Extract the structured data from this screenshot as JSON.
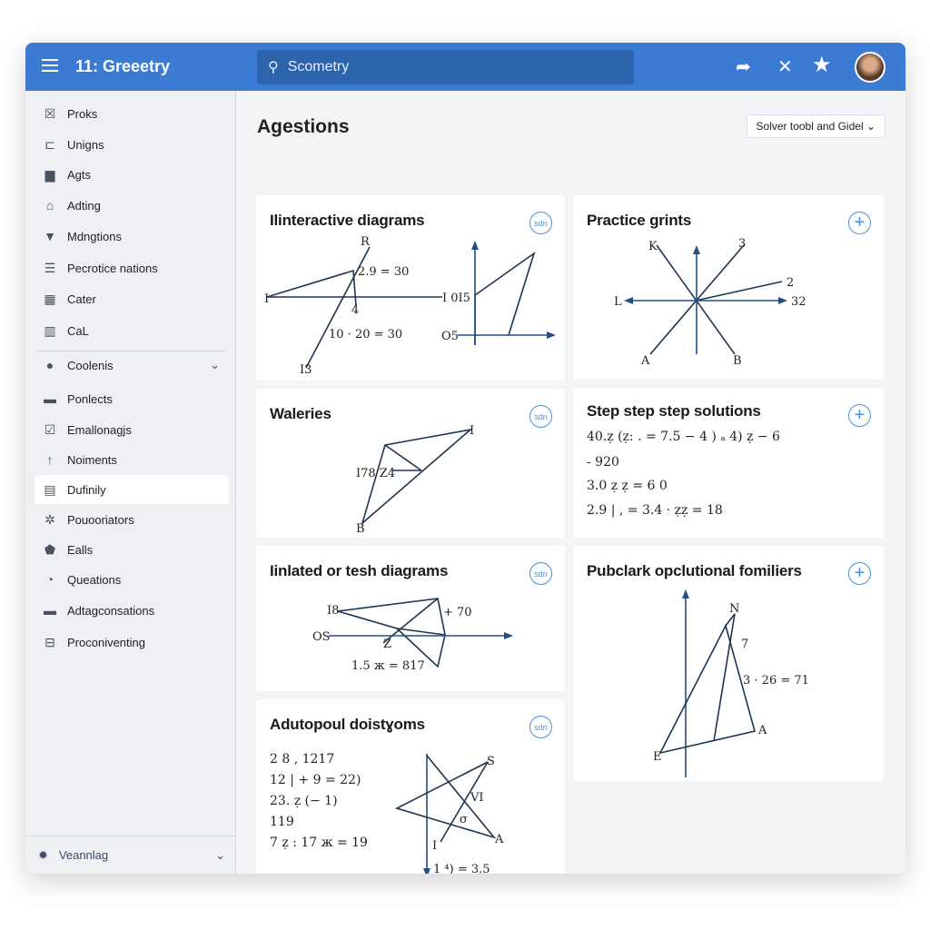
{
  "header": {
    "title": "11: Greeetry",
    "search_value": "Scometry",
    "icons": [
      "share-icon",
      "tools-icon",
      "star-icon"
    ]
  },
  "sidebar": {
    "items": [
      {
        "label": "Proks",
        "icon": "☒"
      },
      {
        "label": "Unigns",
        "icon": "⊏"
      },
      {
        "label": "Agts",
        "icon": "▆"
      },
      {
        "label": "Adting",
        "icon": "⌂"
      },
      {
        "label": "Mdngtions",
        "icon": "▼"
      },
      {
        "label": "Pecrotice nations",
        "icon": "☰"
      },
      {
        "label": "Cater",
        "icon": "▦"
      },
      {
        "label": "CaL",
        "icon": "▥"
      },
      {
        "label": "Coolenis",
        "icon": "●"
      },
      {
        "label": "Ponlects",
        "icon": "▬"
      },
      {
        "label": "Emallonagjs",
        "icon": "☑"
      },
      {
        "label": "Noiments",
        "icon": "↑"
      },
      {
        "label": "Dufinily",
        "icon": "▤"
      },
      {
        "label": "Pouooriators",
        "icon": "✲"
      },
      {
        "label": "Ealls",
        "icon": "⬟"
      },
      {
        "label": "Queations",
        "icon": "◔"
      },
      {
        "label": "Adtagconsations",
        "icon": "▬"
      },
      {
        "label": "Proconiventing",
        "icon": "⊟"
      }
    ],
    "active": "Dufinily",
    "footer": "Veannlag"
  },
  "main": {
    "title": "Agestions",
    "dropdown": "Solver toobl and Gidel",
    "cards": [
      {
        "title": "Ilinteractive diagrams",
        "button": "sdn",
        "labels": [
          "R",
          "2.9 = 30",
          "I",
          "4",
          "10 · 20 = 30",
          "I3",
          "I 0I5",
          "O5"
        ]
      },
      {
        "title": "Practice grints",
        "button": "+",
        "labels": [
          "K",
          "3",
          "2",
          "L",
          "32",
          "A",
          "B"
        ]
      },
      {
        "title": "Waleries",
        "button": "sdn",
        "labels": [
          "I",
          "I78 Z4",
          "B"
        ]
      },
      {
        "title": "Step step step solutions",
        "button": "+",
        "lines": [
          "40.ẓ (ẓ: . = 7.5 − 4 ) ₐ 4) ẓ − 6",
          "- 920",
          "3.0 ẓ ẓ = 6 0",
          "2.9 | , = 3.4 · ẓẓ = 18"
        ]
      },
      {
        "title": "Iinlated or tesh diagrams",
        "button": "sdn",
        "labels": [
          "I8",
          "+ 70",
          "OS",
          "Z",
          "1.5 ж = 817"
        ]
      },
      {
        "title": "Pubclark opclutional fomiliers",
        "button": "+",
        "labels": [
          "N",
          "7",
          "3 · 26 = 71",
          "A",
          "E"
        ]
      },
      {
        "title": "Adutopoul doistɣoms",
        "button": "sdn",
        "lines": [
          "2 8 , 1217",
          "12 | + 9 = 22)",
          "23. ẓ (− 1)",
          "119",
          "7 ẓ : 17 ж = 19"
        ],
        "labels": [
          "S",
          "VI",
          "σ",
          "A",
          "I",
          "1 ⁴) = 3.5"
        ]
      }
    ]
  },
  "colors": {
    "header": "#3b7bd4",
    "accent": "#4a90d8",
    "line": "#1f3550",
    "axis": "#234f82"
  }
}
